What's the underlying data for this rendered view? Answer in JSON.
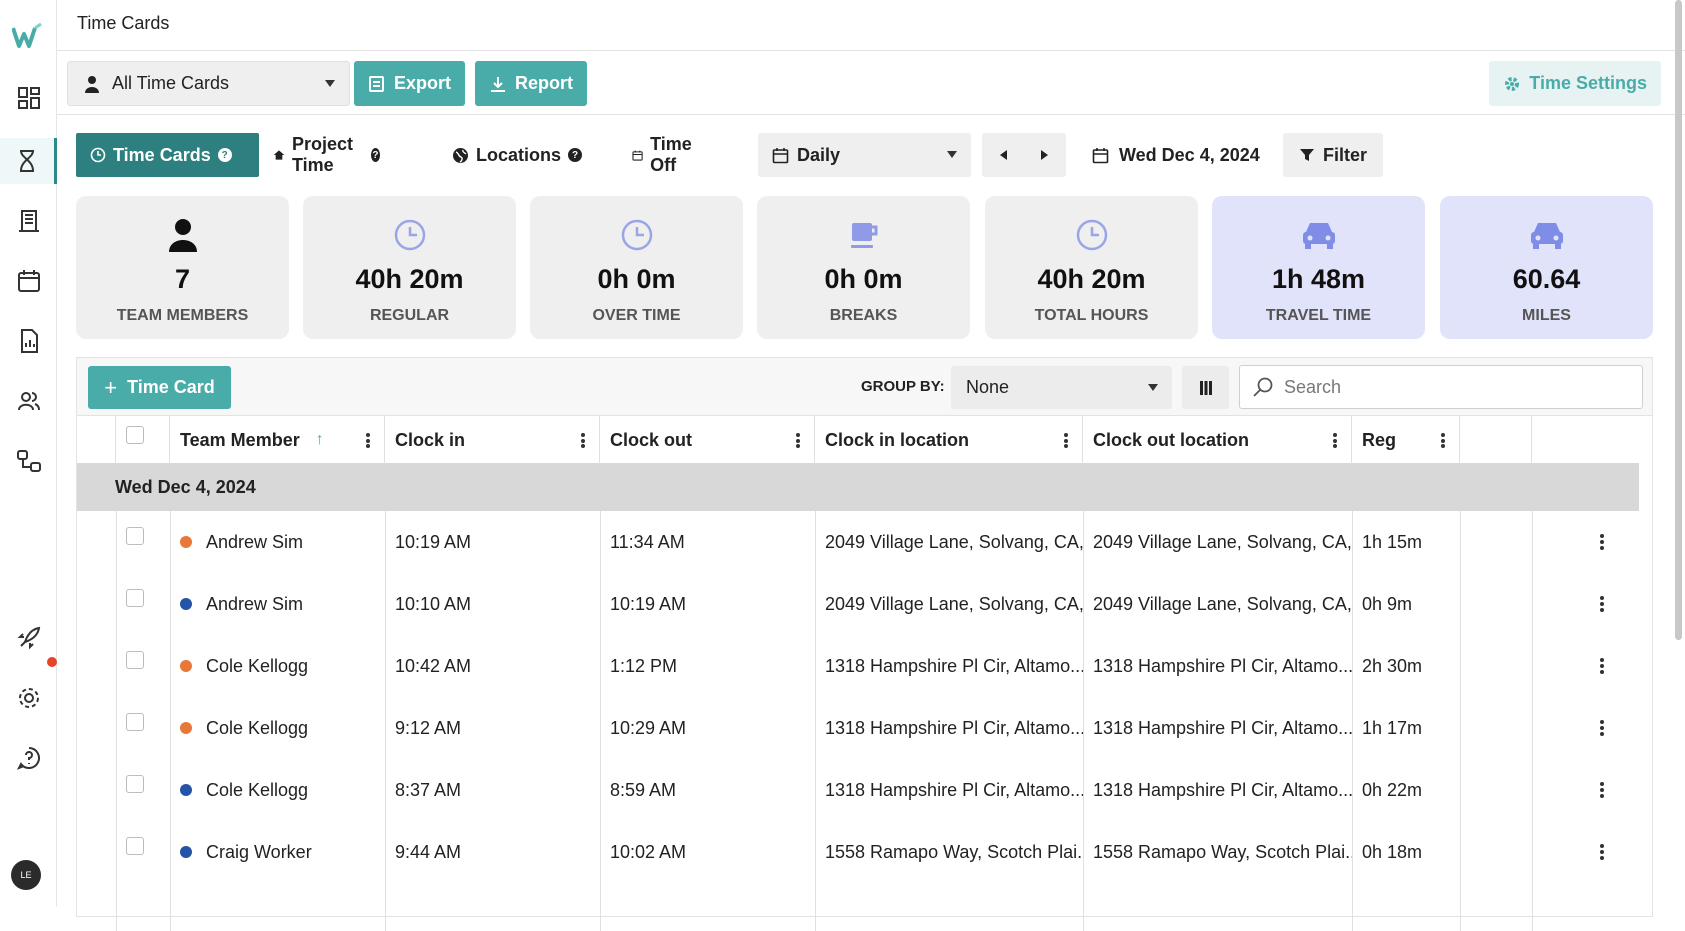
{
  "topbar": {
    "title": "Time Cards"
  },
  "toolbar": {
    "filter_select": "All Time Cards",
    "export_label": "Export",
    "report_label": "Report",
    "settings_label": "Time Settings"
  },
  "tabs": [
    {
      "label": "Time Cards",
      "active": true
    },
    {
      "label": "Project Time"
    },
    {
      "label": "Locations"
    },
    {
      "label": "Time Off"
    }
  ],
  "period_select": "Daily",
  "current_date": "Wed Dec 4, 2024",
  "filter_label": "Filter",
  "stats": [
    {
      "value": "7",
      "label": "TEAM MEMBERS",
      "icon": "person-icon"
    },
    {
      "value": "40h 20m",
      "label": "REGULAR",
      "icon": "clock-icon"
    },
    {
      "value": "0h 0m",
      "label": "OVER TIME",
      "icon": "clock-icon"
    },
    {
      "value": "0h 0m",
      "label": "BREAKS",
      "icon": "coffee-icon"
    },
    {
      "value": "40h 20m",
      "label": "TOTAL HOURS",
      "icon": "clock-icon"
    },
    {
      "value": "1h 48m",
      "label": "TRAVEL TIME",
      "icon": "car-icon"
    },
    {
      "value": "60.64",
      "label": "MILES",
      "icon": "car-icon"
    }
  ],
  "table_toolbar": {
    "add_label": "Time Card",
    "group_by_label": "GROUP BY:",
    "group_by_value": "None",
    "search_placeholder": "Search"
  },
  "columns": [
    "Team Member",
    "Clock in",
    "Clock out",
    "Clock in location",
    "Clock out location",
    "Reg"
  ],
  "group_label": "Wed Dec 4, 2024",
  "rows": [
    {
      "name": "Andrew Sim",
      "dot": "#e8773a",
      "in": "10:19 AM",
      "out": "11:34 AM",
      "in_loc": "2049 Village Lane, Solvang, CA,...",
      "out_loc": "2049 Village Lane, Solvang, CA,...",
      "reg": "1h 15m"
    },
    {
      "name": "Andrew Sim",
      "dot": "#2354a8",
      "in": "10:10 AM",
      "out": "10:19 AM",
      "in_loc": "2049 Village Lane, Solvang, CA,...",
      "out_loc": "2049 Village Lane, Solvang, CA,...",
      "reg": "0h 9m"
    },
    {
      "name": "Cole Kellogg",
      "dot": "#e8773a",
      "in": "10:42 AM",
      "out": "1:12 PM",
      "in_loc": "1318 Hampshire Pl Cir, Altamo...",
      "out_loc": "1318 Hampshire Pl Cir, Altamo...",
      "reg": "2h 30m"
    },
    {
      "name": "Cole Kellogg",
      "dot": "#e8773a",
      "in": "9:12 AM",
      "out": "10:29 AM",
      "in_loc": "1318 Hampshire Pl Cir, Altamo...",
      "out_loc": "1318 Hampshire Pl Cir, Altamo...",
      "reg": "1h 17m"
    },
    {
      "name": "Cole Kellogg",
      "dot": "#2354a8",
      "in": "8:37 AM",
      "out": "8:59 AM",
      "in_loc": "1318 Hampshire Pl Cir, Altamo...",
      "out_loc": "1318 Hampshire Pl Cir, Altamo...",
      "reg": "0h 22m"
    },
    {
      "name": "Craig Worker",
      "dot": "#2354a8",
      "in": "9:44 AM",
      "out": "10:02 AM",
      "in_loc": "1558 Ramapo Way, Scotch Plai...",
      "out_loc": "1558 Ramapo Way, Scotch Plai...",
      "reg": "0h 18m"
    }
  ],
  "avatar_initials": "LE",
  "colors": {
    "accent": "#4aaca9",
    "active_tab": "#2e7f7f",
    "lavender_card": "#e1e3fa"
  }
}
